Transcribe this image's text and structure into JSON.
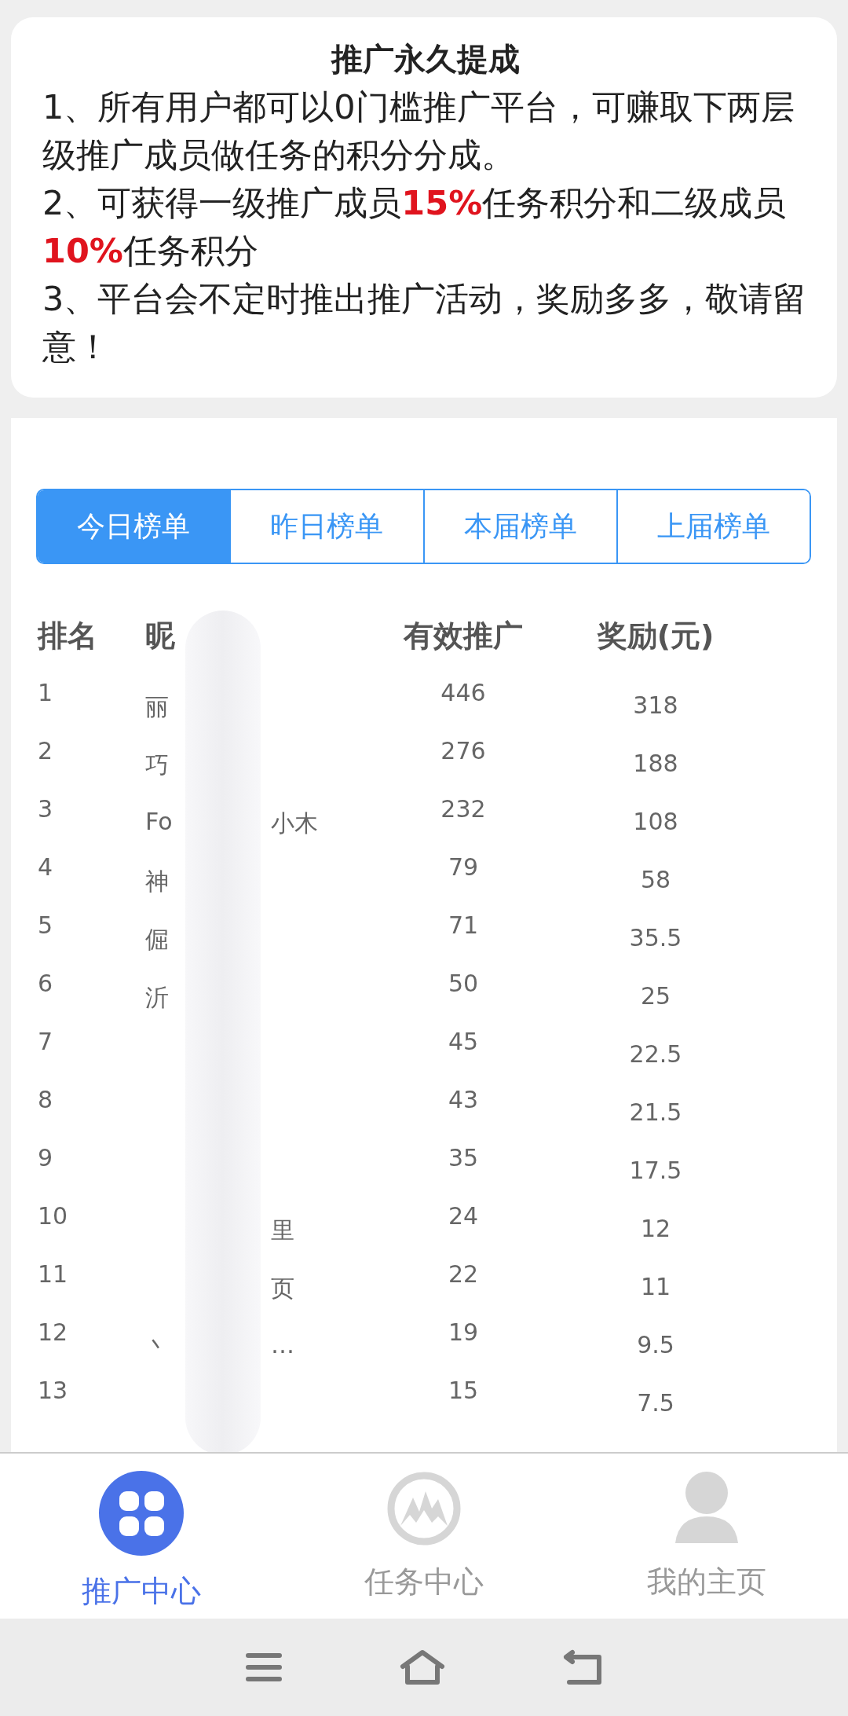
{
  "notice": {
    "title": "推广永久提成",
    "paragraphs": [
      "1、所有用户都可以0门槛推广平台，可赚取下两层级推广成员做任务的积分分成。",
      "2、可获得一级推广成员**15%**任务积分和二级成员**10%**任务积分",
      "3、平台会不定时推出推广活动，奖励多多，敬请留意！"
    ]
  },
  "tabs": [
    {
      "label": "今日榜单",
      "selected": true
    },
    {
      "label": "昨日榜单",
      "selected": false
    },
    {
      "label": "本届榜单",
      "selected": false
    },
    {
      "label": "上届榜单",
      "selected": false
    }
  ],
  "table": {
    "columns": [
      "排名",
      "昵",
      "有效推广",
      "奖励(元)"
    ],
    "rows": [
      {
        "rank": "1",
        "name": "丽",
        "count": "446",
        "reward": "318"
      },
      {
        "rank": "2",
        "name": "巧",
        "count": "276",
        "reward": "188"
      },
      {
        "rank": "3",
        "name": "Fo",
        "name_tail": "小木",
        "count": "232",
        "reward": "108"
      },
      {
        "rank": "4",
        "name": "神",
        "count": "79",
        "reward": "58"
      },
      {
        "rank": "5",
        "name": "倔",
        "count": "71",
        "reward": "35.5"
      },
      {
        "rank": "6",
        "name": "沂",
        "count": "50",
        "reward": "25"
      },
      {
        "rank": "7",
        "count": "45",
        "reward": "22.5"
      },
      {
        "rank": "8",
        "count": "43",
        "reward": "21.5"
      },
      {
        "rank": "9",
        "count": "35",
        "reward": "17.5"
      },
      {
        "rank": "10",
        "name_tail": "里",
        "count": "24",
        "reward": "12"
      },
      {
        "rank": "11",
        "name_tail": "页",
        "count": "22",
        "reward": "11"
      },
      {
        "rank": "12",
        "name": "丶",
        "name_tail": "…",
        "count": "19",
        "reward": "9.5"
      },
      {
        "rank": "13",
        "count": "15",
        "reward": "7.5"
      }
    ]
  },
  "bottom_nav": [
    {
      "label": "推广中心",
      "kind": "grid",
      "selected": true
    },
    {
      "label": "任务中心",
      "kind": "mountain",
      "selected": false
    },
    {
      "label": "我的主页",
      "kind": "person",
      "selected": false
    }
  ]
}
